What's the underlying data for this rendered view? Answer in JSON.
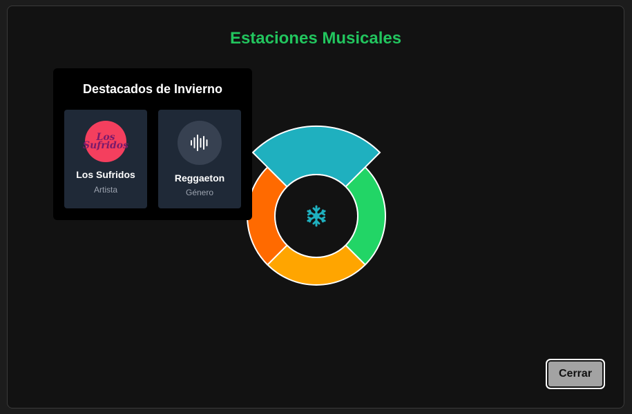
{
  "modal": {
    "title": "Estaciones Musicales",
    "close_label": "Cerrar"
  },
  "wheel": {
    "center_icon": "snowflake-icon",
    "segments": [
      {
        "name": "top",
        "color": "#1fb0bf",
        "active": true
      },
      {
        "name": "right",
        "color": "#22d566"
      },
      {
        "name": "bottom",
        "color": "#ffa500"
      },
      {
        "name": "left",
        "color": "#ff6a00"
      }
    ],
    "center_icon_color": "#1fb0bf"
  },
  "popup": {
    "title": "Destacados de Invierno",
    "items": [
      {
        "name": "Los Sufridos",
        "type": "Artista",
        "image_text": "Los Sufridos",
        "icon": "artist-avatar"
      },
      {
        "name": "Reggaeton",
        "type": "Género",
        "icon": "audio-waveform-icon"
      }
    ]
  },
  "colors": {
    "accent": "#22c55e",
    "background": "#121212"
  }
}
